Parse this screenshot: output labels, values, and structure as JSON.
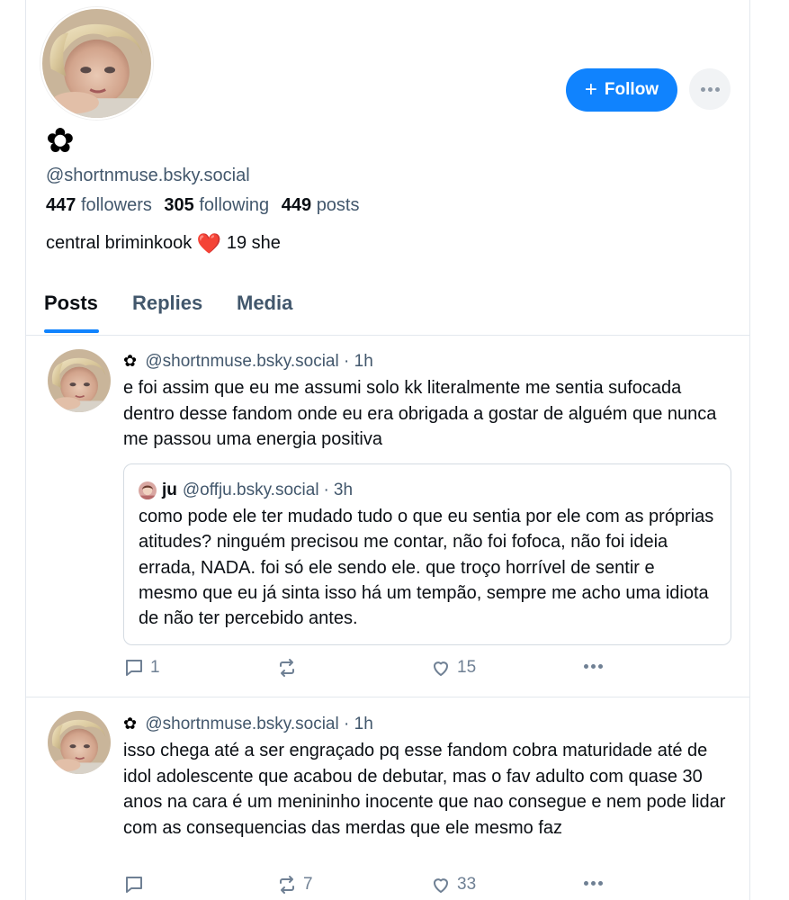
{
  "profile": {
    "display_name": "✿",
    "handle": "@shortnmuse.bsky.social",
    "followers_count": "447",
    "followers_label": "followers",
    "following_count": "305",
    "following_label": "following",
    "posts_count": "449",
    "posts_label": "posts",
    "bio_prefix": "central briminkook",
    "bio_emoji": "❤️",
    "bio_suffix": "19 she",
    "follow_label": "Follow",
    "follow_icon": "plus-icon",
    "more_icon": "ellipsis-icon"
  },
  "tabs": [
    {
      "label": "Posts",
      "active": true
    },
    {
      "label": "Replies",
      "active": false
    },
    {
      "label": "Media",
      "active": false
    }
  ],
  "posts": [
    {
      "author_flower": "✿",
      "handle": "@shortnmuse.bsky.social",
      "separator": "·",
      "time": "1h",
      "text": "e foi assim que eu me assumi solo kk literalmente me sentia sufocada dentro desse fandom onde eu era obrigada a gostar de alguém que nunca me passou uma energia positiva",
      "quote": {
        "name": "ju",
        "handle": "@offju.bsky.social",
        "separator": "·",
        "time": "3h",
        "text": "como pode ele ter mudado tudo o que eu sentia por ele com as próprias atitudes? ninguém precisou me contar, não foi fofoca, não foi ideia errada, NADA. foi só ele sendo ele. que troço horrível de sentir e mesmo que eu já sinta isso há um tempão, sempre me acho uma idiota de não ter percebido antes."
      },
      "replies": "1",
      "reposts": "",
      "likes": "15"
    },
    {
      "author_flower": "✿",
      "handle": "@shortnmuse.bsky.social",
      "separator": "·",
      "time": "1h",
      "text": "isso chega até a ser engraçado pq esse fandom cobra maturidade até de idol adolescente que acabou de debutar, mas o fav adulto com quase 30 anos na cara é um menininho inocente que nao consegue e nem pode lidar com as consequencias das merdas que ele mesmo faz",
      "replies": "",
      "reposts": "7",
      "likes": "33"
    }
  ],
  "colors": {
    "accent": "#1083fe",
    "muted_text": "#42576c",
    "icon_gray": "#6f8094",
    "border": "#e3e8ee",
    "heart": "#e8274b"
  }
}
